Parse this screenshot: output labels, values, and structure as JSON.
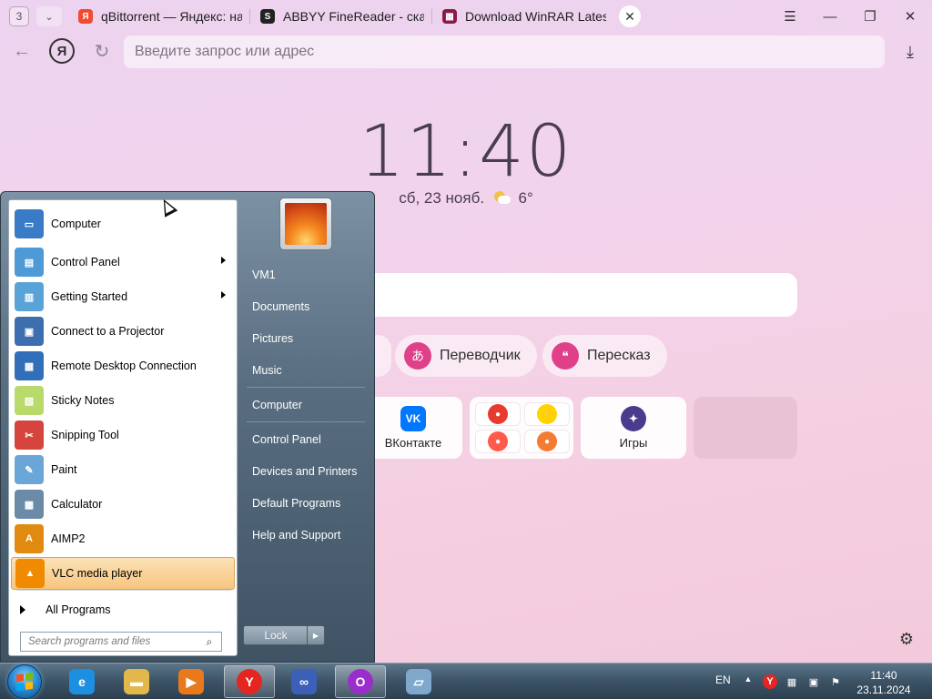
{
  "browser": {
    "tab_counter": "3",
    "tabs": [
      {
        "title": "qBittorrent — Яндекс: нашлось",
        "favicon": "yandex-icon",
        "color": "#f04b2e",
        "glyph": "Я"
      },
      {
        "title": "ABBYY FineReader - скачать",
        "favicon": "s-icon",
        "color": "#222222",
        "glyph": "S"
      },
      {
        "title": "Download WinRAR Latest",
        "favicon": "winrar-icon",
        "color": "#8b1a4a",
        "glyph": "▦"
      }
    ],
    "address_placeholder": "Введите запрос или адрес"
  },
  "newtab": {
    "clock": "11:40",
    "date": "сб, 23 нояб.",
    "temperature": "6°",
    "pills": [
      {
        "label": "Переводчик",
        "icon": "translate-icon",
        "glyph": "あ"
      },
      {
        "label": "Пересказ",
        "icon": "retell-icon",
        "glyph": "❝"
      }
    ],
    "tiles": [
      {
        "label": "ВКонтакте",
        "icon": "vk-icon",
        "glyph": "VK",
        "color": "#0077ff"
      },
      {
        "label": "Игры",
        "icon": "games-icon",
        "glyph": "✦",
        "color": "#4b3b8f"
      }
    ]
  },
  "start_menu": {
    "left_items": [
      {
        "label": "Computer",
        "icon": "computer-icon",
        "color": "#3a7bc8",
        "glyph": "▭",
        "arrow": false
      },
      {
        "label": "Control Panel",
        "icon": "control-panel-icon",
        "color": "#4d9ad6",
        "glyph": "▤",
        "arrow": true
      },
      {
        "label": "Getting Started",
        "icon": "getting-started-icon",
        "color": "#5aa3d8",
        "glyph": "▥",
        "arrow": true
      },
      {
        "label": "Connect to a Projector",
        "icon": "projector-icon",
        "color": "#3d6fb0",
        "glyph": "▣",
        "arrow": false
      },
      {
        "label": "Remote Desktop Connection",
        "icon": "remote-desktop-icon",
        "color": "#3170b8",
        "glyph": "▦",
        "arrow": false
      },
      {
        "label": "Sticky Notes",
        "icon": "sticky-notes-icon",
        "color": "#b9d96a",
        "glyph": "▧",
        "arrow": false
      },
      {
        "label": "Snipping Tool",
        "icon": "snipping-tool-icon",
        "color": "#d6453d",
        "glyph": "✂",
        "arrow": false
      },
      {
        "label": "Paint",
        "icon": "paint-icon",
        "color": "#6aa6d8",
        "glyph": "✎",
        "arrow": false
      },
      {
        "label": "Calculator",
        "icon": "calculator-icon",
        "color": "#6b8aa8",
        "glyph": "▩",
        "arrow": false
      },
      {
        "label": "AIMP2",
        "icon": "aimp-icon",
        "color": "#e08a10",
        "glyph": "A",
        "arrow": false
      },
      {
        "label": "VLC media player",
        "icon": "vlc-icon",
        "color": "#f08a00",
        "glyph": "▲",
        "arrow": false
      }
    ],
    "all_programs": "All Programs",
    "search_placeholder": "Search programs and files",
    "right_items": [
      "VM1",
      "Documents",
      "Pictures",
      "Music",
      "Computer",
      "Control Panel",
      "Devices and Printers",
      "Default Programs",
      "Help and Support"
    ],
    "lock_label": "Lock"
  },
  "taskbar": {
    "apps": [
      {
        "name": "internet-explorer",
        "icon": "ie-icon",
        "glyph": "e",
        "color": "#1c8fe0"
      },
      {
        "name": "file-explorer",
        "icon": "folder-icon",
        "glyph": "▬",
        "color": "#e2b84a"
      },
      {
        "name": "media-player",
        "icon": "media-player-icon",
        "glyph": "▶",
        "color": "#e87a1c"
      },
      {
        "name": "yandex-browser",
        "icon": "yandex-browser-icon",
        "glyph": "Y",
        "color": "#e52620"
      },
      {
        "name": "infinity-app",
        "icon": "infinity-icon",
        "glyph": "∞",
        "color": "#3c5fb8"
      },
      {
        "name": "opera-like-app",
        "icon": "circle-app-icon",
        "glyph": "O",
        "color": "#9b2ecb"
      },
      {
        "name": "window-app",
        "icon": "window-app-icon",
        "glyph": "▱",
        "color": "#7fa8cc"
      }
    ],
    "language": "EN",
    "time": "11:40",
    "date": "23.11.2024"
  }
}
